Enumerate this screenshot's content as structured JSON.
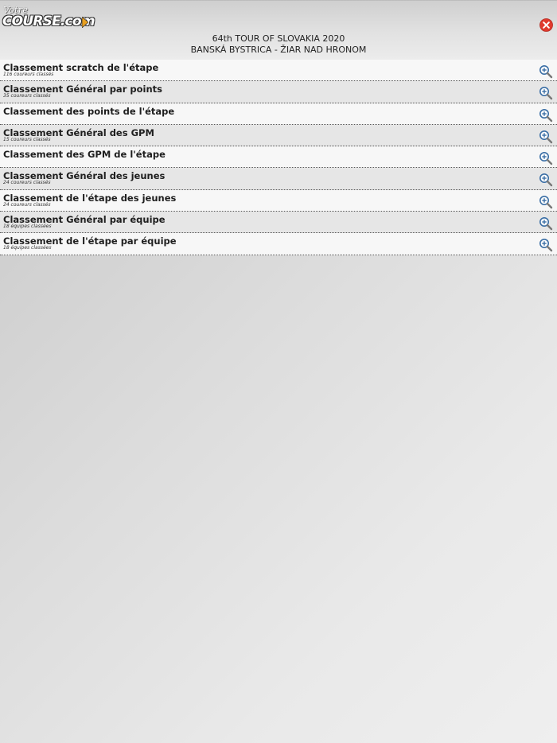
{
  "brand": {
    "logo_top": "Votre",
    "logo_main": "COURSE.com",
    "accent_color": "#e8a020"
  },
  "header": {
    "race_title": "64th TOUR OF SLOVAKIA 2020",
    "stage_title": "BANSKÁ BYSTRICA - ŽIAR NAD HRONOM",
    "close_icon": "close-icon",
    "close_color": "#e03a2e"
  },
  "rankings": [
    {
      "title": "Classement scratch de l'étape",
      "subtitle": "116 coureurs classés"
    },
    {
      "title": "Classement Général par points",
      "subtitle": "35 coureurs classés"
    },
    {
      "title": "Classement des points de l'étape",
      "subtitle": ""
    },
    {
      "title": "Classement Général des GPM",
      "subtitle": "15 coureurs classés"
    },
    {
      "title": "Classement des GPM de l'étape",
      "subtitle": ""
    },
    {
      "title": "Classement Général des jeunes",
      "subtitle": "24 coureurs classés"
    },
    {
      "title": "Classement de l'étape des jeunes",
      "subtitle": "24 coureurs classés"
    },
    {
      "title": "Classement Général par équipe",
      "subtitle": "18 équipes classées"
    },
    {
      "title": "Classement de l'étape par équipe",
      "subtitle": "18 équipes classées"
    }
  ],
  "row_icon": "zoom-in-icon"
}
